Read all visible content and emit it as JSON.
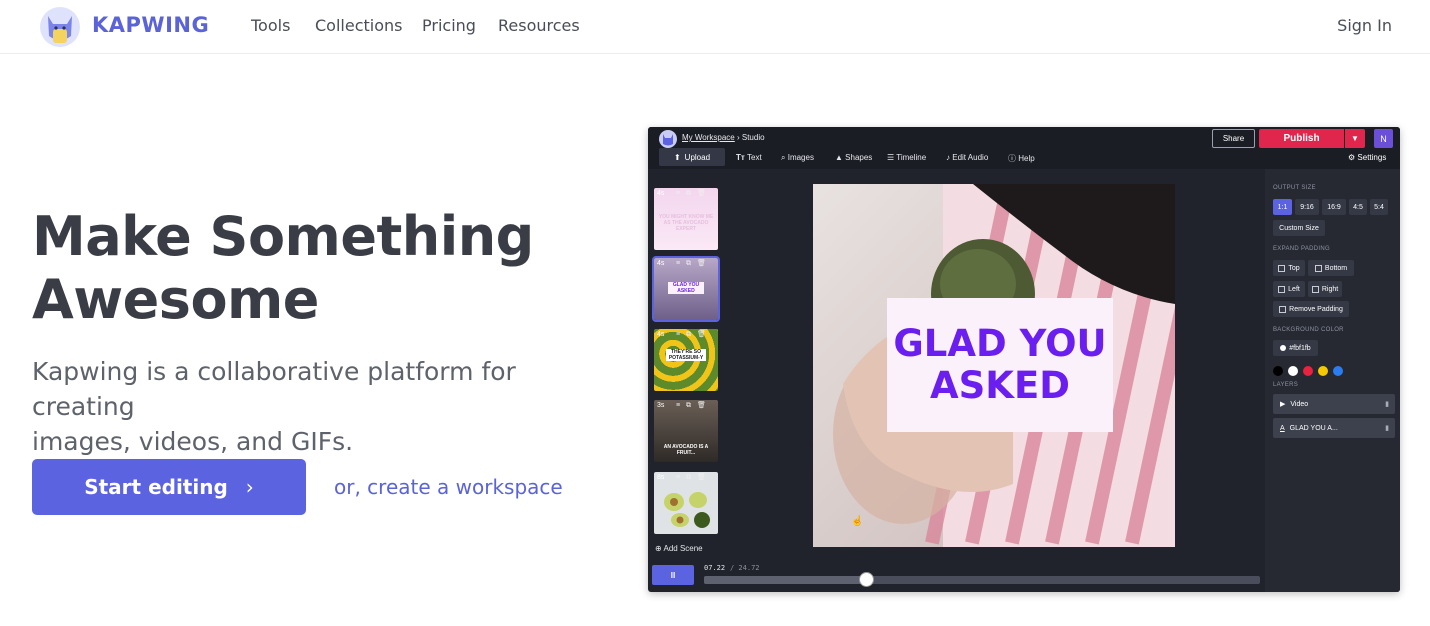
{
  "nav": {
    "brand": "KAPWING",
    "links": [
      "Tools",
      "Collections",
      "Pricing",
      "Resources"
    ],
    "sign_in": "Sign In"
  },
  "hero": {
    "title_line1": "Make Something",
    "title_line2": "Awesome",
    "subtitle_line1": "Kapwing is a collaborative platform for creating",
    "subtitle_line2": "images, videos, and GIFs.",
    "start_button": "Start editing",
    "start_chevron": "›",
    "workspace_link": "or, create a workspace"
  },
  "colors": {
    "brand": "#5b63e0",
    "publish": "#e1264e",
    "caption_text": "#6a1ff0",
    "caption_bg": "#fbf1fb"
  },
  "editor": {
    "breadcrumb_workspace": "My Workspace",
    "breadcrumb_sep": " › ",
    "breadcrumb_page": "Studio",
    "upload": "Upload",
    "tools": [
      {
        "icon": "text-icon",
        "glyph": "Tт",
        "label": "Text"
      },
      {
        "icon": "search-icon",
        "glyph": "🔍",
        "label": "Images"
      },
      {
        "icon": "shapes-icon",
        "glyph": "▲",
        "label": "Shapes"
      },
      {
        "icon": "timeline-icon",
        "glyph": "☰",
        "label": "Timeline"
      },
      {
        "icon": "music-icon",
        "glyph": "♪",
        "label": "Edit Audio"
      },
      {
        "icon": "help-icon",
        "glyph": "?",
        "label": "Help"
      }
    ],
    "share": "Share",
    "publish": "Publish",
    "user_initial": "N",
    "settings": "Settings",
    "scenes": [
      {
        "duration": "4s",
        "text": "YOU MIGHT KNOW ME AS THE AVOCADO EXPERT"
      },
      {
        "duration": "4s",
        "text": "GLAD YOU ASKED"
      },
      {
        "duration": "4s",
        "text": "THEY'RE SO POTASSIUM-Y"
      },
      {
        "duration": "3s",
        "text": "AN AVOCADO IS A FRUIT..."
      },
      {
        "duration": "8s",
        "text": ""
      }
    ],
    "add_scene": "Add Scene",
    "caption_line1": "GLAD YOU",
    "caption_line2": "ASKED",
    "play": "II",
    "time_current": "07.22",
    "time_total": "/ 24.72",
    "progress_fraction": 0.292,
    "panel": {
      "output_size_label": "OUTPUT SIZE",
      "sizes": [
        "1:1",
        "9:16",
        "16:9",
        "4:5",
        "5:4"
      ],
      "custom_size": "Custom Size",
      "expand_padding_label": "EXPAND PADDING",
      "pad_top": "Top",
      "pad_bottom": "Bottom",
      "pad_left": "Left",
      "pad_right": "Right",
      "remove_padding": "Remove Padding",
      "background_color_label": "BACKGROUND COLOR",
      "background_color_value": "#fbf1fb",
      "swatches": [
        "#000000",
        "#ffffff",
        "#e8223f",
        "#f5c800",
        "#2a7cf0"
      ],
      "layers_label": "LAYERS",
      "layers": [
        {
          "icon": "play-icon",
          "glyph": "▶",
          "label": "Video"
        },
        {
          "icon": "text-layer-icon",
          "glyph": "A",
          "label": "GLAD YOU A..."
        }
      ]
    }
  }
}
